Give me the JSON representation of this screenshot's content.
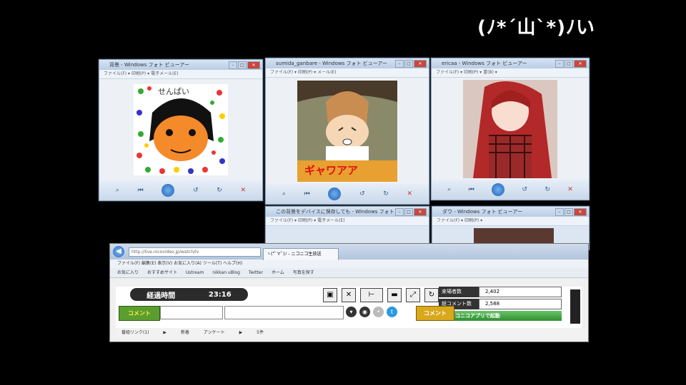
{
  "overlay": {
    "text": "(ﾉ*´山`*)ﾉい"
  },
  "viewers": [
    {
      "title": "背景 - Windows フォト ビューアー",
      "menu": "ファイル(F) ▾  印刷(P) ▾  電子メール(E)"
    },
    {
      "title": "sumida_ganbare - Windows フォト ビューアー",
      "menu": "ファイル(F) ▾  印刷(P) ▾  メール(E)"
    },
    {
      "title": "ericaa - Windows フォト ビューアー",
      "menu": "ファイル(F) ▾  印刷(P) ▾  書(B) ▾"
    },
    {
      "title": "この背景をデバイスに保存しても - Windows フォト ビ",
      "menu": "ファイル(F) ▾  印刷(P) ▾  電子メール(E)"
    },
    {
      "title": "ダウ - Windows フォト ビューアー",
      "menu": "ファイル(F) ▾  印刷(P) ▾"
    }
  ],
  "viewer_toolbar": {
    "prev": "⏮",
    "rotate_left": "↺",
    "rotate_right": "↻",
    "delete": "✕",
    "zoom": "⌕"
  },
  "painting": {
    "caption": "せんぱい",
    "bottom_text": "ギャワアア"
  },
  "browser": {
    "back": "◀",
    "address": "http://live.nicovideo.jp/watch/lv",
    "tab": "ヽ(*ﾟ∀ﾟ)ﾉ - ニコニコ生放送",
    "menu": "ファイル(F)  編集(E)  表示(V)  お気に入り(A)  ツール(T)  ヘルプ(H)",
    "favorites": [
      "お気に入り",
      "おすすめサイト",
      "Ustream",
      "nikkan uBlog",
      "Twitter",
      "ホーム",
      "写真を探す"
    ],
    "elapsed_label": "経過時間",
    "elapsed_value": "23:16",
    "visitors_label": "来場者数",
    "visitors_value": "2,402",
    "comments_label": "総コメント数",
    "comments_value": "2,588",
    "nico_app": "▶ ニコニコアプリで起動",
    "comment_button": "コメント",
    "submit_button": "コメント",
    "bottom_items": [
      "番組リンク(1)",
      "▶",
      "新着",
      "アンケート",
      "▶",
      "5件"
    ]
  }
}
